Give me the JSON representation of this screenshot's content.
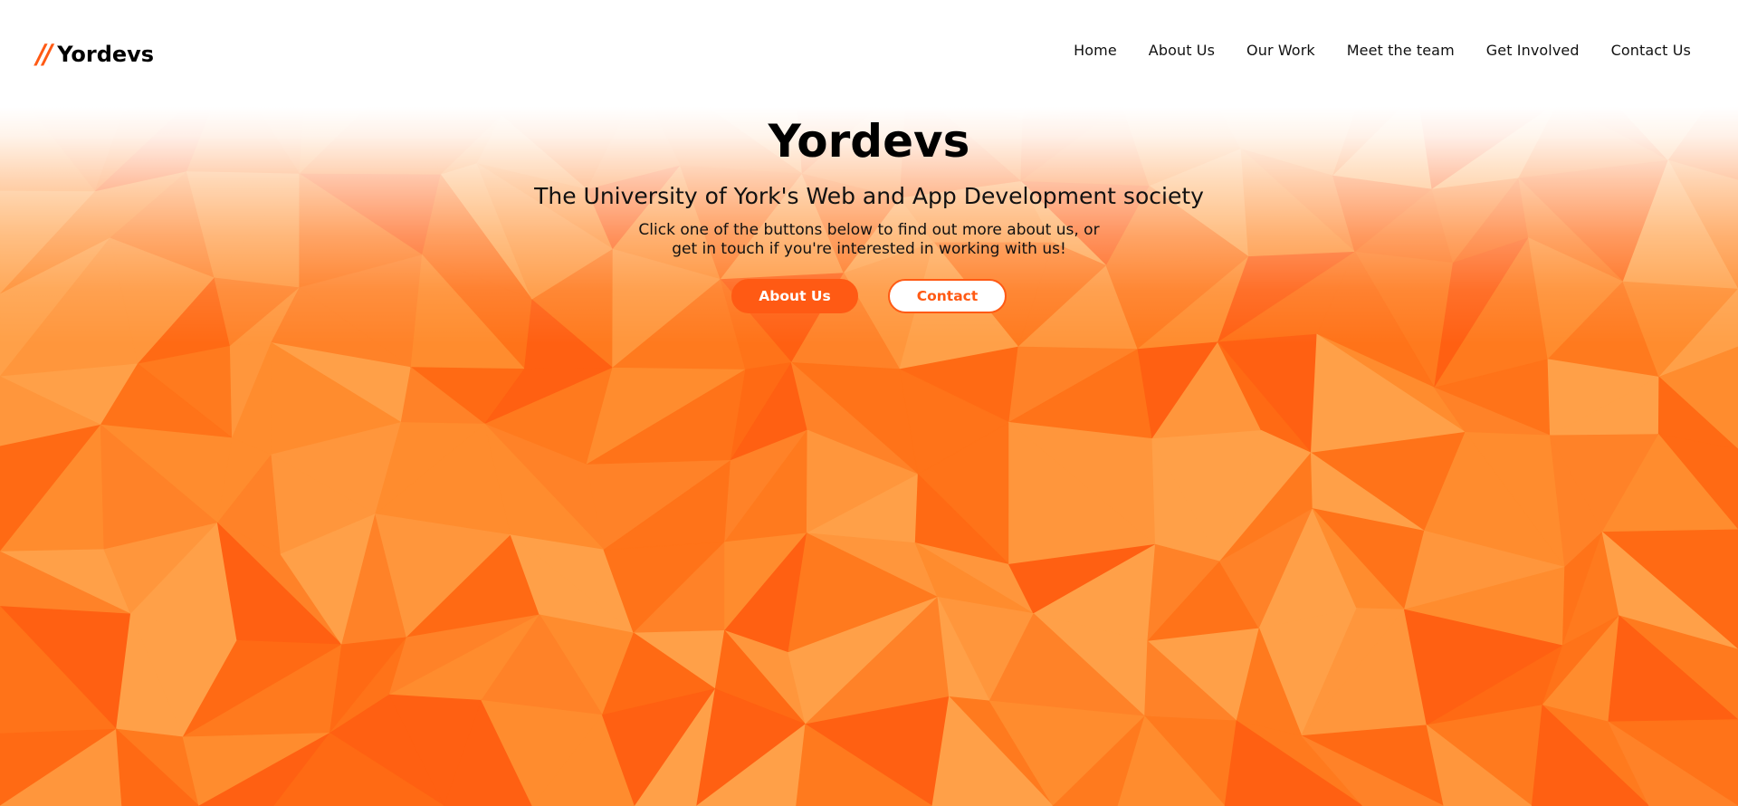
{
  "colors": {
    "accent": "#ff5a14",
    "hero_base": "#ff7a1e",
    "text": "#000000",
    "background": "#ffffff"
  },
  "header": {
    "logo_mark": "//",
    "logo_text": "Yordevs",
    "nav": [
      {
        "label": "Home"
      },
      {
        "label": "About Us"
      },
      {
        "label": "Our Work"
      },
      {
        "label": "Meet the team"
      },
      {
        "label": "Get Involved"
      },
      {
        "label": "Contact Us"
      }
    ]
  },
  "hero": {
    "title": "Yordevs",
    "subtitle": "The University of York's Web and App Development society",
    "description_line1": "Click one of the buttons below to find out more about us, or",
    "description_line2": "get in touch if you're interested in working with us!",
    "primary_button": "About Us",
    "secondary_button": "Contact"
  }
}
